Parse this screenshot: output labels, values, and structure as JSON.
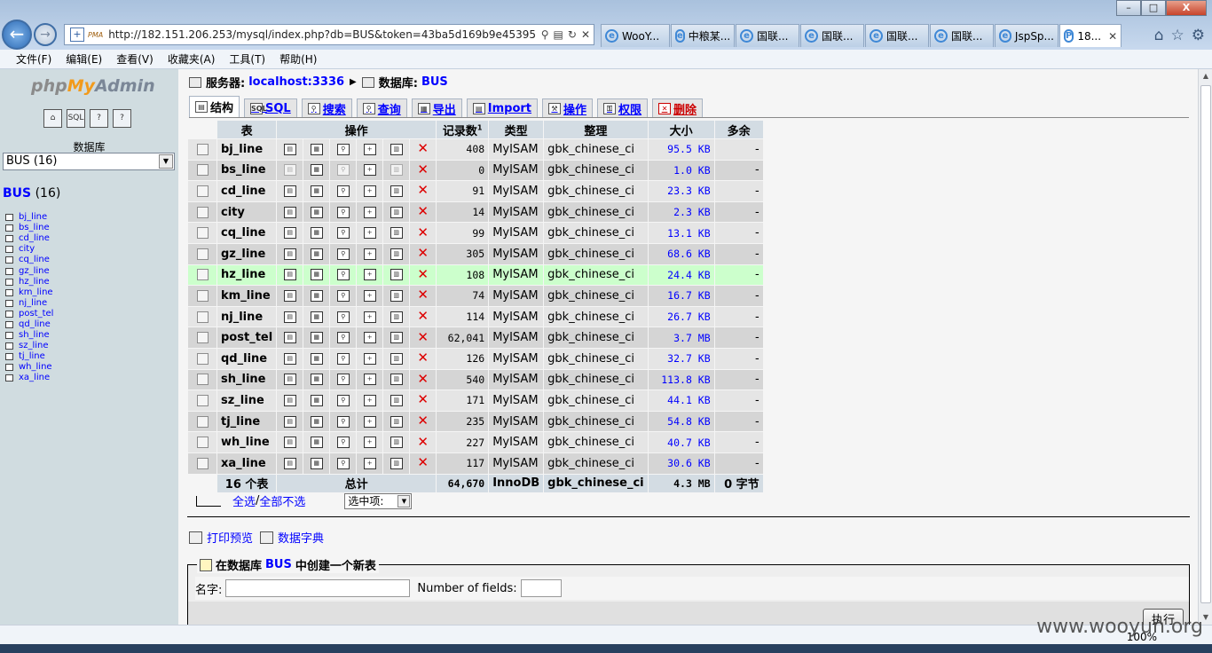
{
  "browser": {
    "window_buttons": {
      "minimize": "–",
      "maximize": "□",
      "close": "X"
    },
    "address_url": "http://182.151.206.253/mysql/index.php?db=BUS&token=43ba5d169b9e45395",
    "address_icons": [
      "search-icon",
      "compat-icon",
      "refresh-icon",
      "stop-icon"
    ],
    "pma_favicon": "PMA",
    "tabs": [
      {
        "label": "WooY...",
        "icon": "ie-icon"
      },
      {
        "label": "中粮某...",
        "icon": "ie-icon"
      },
      {
        "label": "国联...",
        "icon": "ie-icon"
      },
      {
        "label": "国联...",
        "icon": "ie-icon"
      },
      {
        "label": "国联...",
        "icon": "ie-icon"
      },
      {
        "label": "国联...",
        "icon": "ie-icon"
      },
      {
        "label": "JspSp...",
        "icon": "ie-icon"
      },
      {
        "label": "18...",
        "icon": "pma-icon",
        "active": true
      }
    ],
    "menu": [
      "文件(F)",
      "编辑(E)",
      "查看(V)",
      "收藏夹(A)",
      "工具(T)",
      "帮助(H)"
    ],
    "zoom": "100%"
  },
  "sidebar": {
    "logo_php": "php",
    "logo_my": "My",
    "logo_admin": "Admin",
    "db_label": "数据库",
    "db_select": "BUS (16)",
    "db_name": "BUS",
    "db_count": "(16)",
    "tables": [
      "bj_line",
      "bs_line",
      "cd_line",
      "city",
      "cq_line",
      "gz_line",
      "hz_line",
      "km_line",
      "nj_line",
      "post_tel",
      "qd_line",
      "sh_line",
      "sz_line",
      "tj_line",
      "wh_line",
      "xa_line"
    ]
  },
  "header": {
    "server_label": "服务器:",
    "server_value": "localhost:3336",
    "db_label": "数据库:",
    "db_value": "BUS"
  },
  "page_tabs": [
    {
      "label": "结构",
      "active": true
    },
    {
      "label": "SQL"
    },
    {
      "label": "搜索"
    },
    {
      "label": "查询"
    },
    {
      "label": "导出"
    },
    {
      "label": "Import"
    },
    {
      "label": "操作"
    },
    {
      "label": "权限"
    },
    {
      "label": "删除"
    }
  ],
  "table_headers": {
    "table": "表",
    "action": "操作",
    "records": "记录数",
    "records_sup": "1",
    "type": "类型",
    "collation": "整理",
    "size": "大小",
    "overhead": "多余"
  },
  "rows": [
    {
      "name": "bj_line",
      "records": "408",
      "type": "MyISAM",
      "collation": "gbk_chinese_ci",
      "size": "95.5 KB",
      "overhead": "-"
    },
    {
      "name": "bs_line",
      "records": "0",
      "type": "MyISAM",
      "collation": "gbk_chinese_ci",
      "size": "1.0 KB",
      "overhead": "-",
      "empty": true
    },
    {
      "name": "cd_line",
      "records": "91",
      "type": "MyISAM",
      "collation": "gbk_chinese_ci",
      "size": "23.3 KB",
      "overhead": "-"
    },
    {
      "name": "city",
      "records": "14",
      "type": "MyISAM",
      "collation": "gbk_chinese_ci",
      "size": "2.3 KB",
      "overhead": "-"
    },
    {
      "name": "cq_line",
      "records": "99",
      "type": "MyISAM",
      "collation": "gbk_chinese_ci",
      "size": "13.1 KB",
      "overhead": "-"
    },
    {
      "name": "gz_line",
      "records": "305",
      "type": "MyISAM",
      "collation": "gbk_chinese_ci",
      "size": "68.6 KB",
      "overhead": "-"
    },
    {
      "name": "hz_line",
      "records": "108",
      "type": "MyISAM",
      "collation": "gbk_chinese_ci",
      "size": "24.4 KB",
      "overhead": "-",
      "highlight": true
    },
    {
      "name": "km_line",
      "records": "74",
      "type": "MyISAM",
      "collation": "gbk_chinese_ci",
      "size": "16.7 KB",
      "overhead": "-"
    },
    {
      "name": "nj_line",
      "records": "114",
      "type": "MyISAM",
      "collation": "gbk_chinese_ci",
      "size": "26.7 KB",
      "overhead": "-"
    },
    {
      "name": "post_tel",
      "records": "62,041",
      "type": "MyISAM",
      "collation": "gbk_chinese_ci",
      "size": "3.7 MB",
      "overhead": "-"
    },
    {
      "name": "qd_line",
      "records": "126",
      "type": "MyISAM",
      "collation": "gbk_chinese_ci",
      "size": "32.7 KB",
      "overhead": "-"
    },
    {
      "name": "sh_line",
      "records": "540",
      "type": "MyISAM",
      "collation": "gbk_chinese_ci",
      "size": "113.8 KB",
      "overhead": "-"
    },
    {
      "name": "sz_line",
      "records": "171",
      "type": "MyISAM",
      "collation": "gbk_chinese_ci",
      "size": "44.1 KB",
      "overhead": "-"
    },
    {
      "name": "tj_line",
      "records": "235",
      "type": "MyISAM",
      "collation": "gbk_chinese_ci",
      "size": "54.8 KB",
      "overhead": "-"
    },
    {
      "name": "wh_line",
      "records": "227",
      "type": "MyISAM",
      "collation": "gbk_chinese_ci",
      "size": "40.7 KB",
      "overhead": "-"
    },
    {
      "name": "xa_line",
      "records": "117",
      "type": "MyISAM",
      "collation": "gbk_chinese_ci",
      "size": "30.6 KB",
      "overhead": "-"
    }
  ],
  "action_icons": [
    "browse-icon",
    "structure-icon",
    "search-icon",
    "insert-icon",
    "empty-icon",
    "drop-icon"
  ],
  "totals": {
    "count": "16 个表",
    "label": "总计",
    "records": "64,670",
    "type": "InnoDB",
    "collation": "gbk_chinese_ci",
    "size": "4.3 MB",
    "overhead": "0 字节"
  },
  "selection": {
    "check_all": "全选",
    "separator": " / ",
    "uncheck_all": "全部不选",
    "with_selected": "选中项:"
  },
  "extra_links": {
    "print": "打印预览",
    "dictionary": "数据字典"
  },
  "create": {
    "legend_prefix": "在数据库",
    "db": "BUS",
    "legend_suffix": "中创建一个新表",
    "name_label": "名字:",
    "fields_label": "Number of fields:",
    "name_value": "",
    "fields_value": "",
    "go_button": "执行"
  },
  "watermark": "www.wooyun.org"
}
